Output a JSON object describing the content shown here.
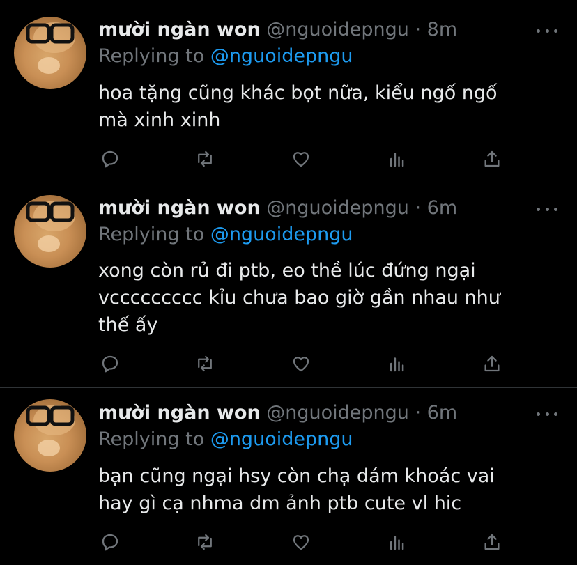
{
  "tweets": [
    {
      "name": "mười ngàn won",
      "handle": "@nguoidepngu",
      "time": "8m",
      "replying_prefix": "Replying to",
      "replying_to": "@nguoidepngu",
      "text": "hoa tặng cũng khác bọt nữa, kiểu ngố ngố\nmà xinh xinh"
    },
    {
      "name": "mười ngàn won",
      "handle": "@nguoidepngu",
      "time": "6m",
      "replying_prefix": "Replying to",
      "replying_to": "@nguoidepngu",
      "text": "xong còn rủ đi ptb, eo thề lúc đứng ngại\nvccccccccc kỉu chưa bao giờ gần nhau như\nthế ấy"
    },
    {
      "name": "mười ngàn won",
      "handle": "@nguoidepngu",
      "time": "6m",
      "replying_prefix": "Replying to",
      "replying_to": "@nguoidepngu",
      "text": "bạn cũng ngại hsy còn chạ dám khoác vai\nhay gì cạ nhma dm ảnh ptb cute vl hic"
    }
  ],
  "separator": " · ",
  "icons": [
    "reply-icon",
    "retweet-icon",
    "like-icon",
    "analytics-icon",
    "share-icon",
    "more-icon"
  ],
  "colors": {
    "background": "#000000",
    "text": "#e7e9ea",
    "secondary": "#71767b",
    "link": "#1d9bf0",
    "divider": "#2f3336"
  }
}
